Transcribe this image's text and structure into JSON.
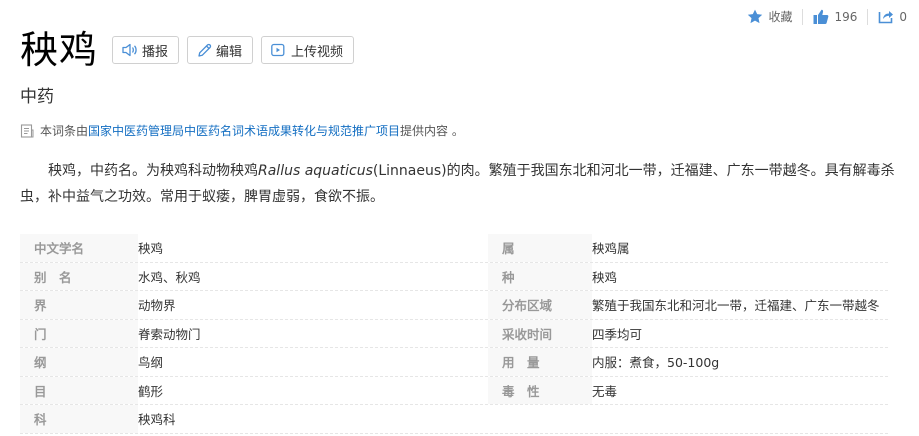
{
  "actions": {
    "favorite_label": "收藏",
    "like_count": "196",
    "share_count": "0"
  },
  "entry": {
    "title": "秧鸡",
    "subtitle": "中药",
    "buttons": {
      "broadcast": "播报",
      "edit": "编辑",
      "upload_video": "上传视频"
    }
  },
  "source": {
    "prefix": "本词条由",
    "link": "国家中医药管理局中医药名词术语成果转化与规范推广项目",
    "suffix": " 提供内容 。"
  },
  "summary": {
    "part1": "秧鸡，中药名。为秧鸡科动物秧鸡",
    "latin": "Rallus aquaticus",
    "part2": "(Linnaeus)的肉。繁殖于我国东北和河北一带，迁福建、广东一带越冬。具有解毒杀虫，补中益气之功效。常用于蚁瘘，脾胃虚弱，食欲不振。"
  },
  "infobox": {
    "left": [
      {
        "label": "中文学名",
        "value": "秧鸡"
      },
      {
        "label": "别　名",
        "value": "水鸡、秋鸡"
      },
      {
        "label": "界",
        "value": "动物界"
      },
      {
        "label": "门",
        "value": "脊索动物门"
      },
      {
        "label": "纲",
        "value": "鸟纲"
      },
      {
        "label": "目",
        "value": "鹤形"
      },
      {
        "label": "科",
        "value": "秧鸡科"
      }
    ],
    "right": [
      {
        "label": "属",
        "value": "秧鸡属"
      },
      {
        "label": "种",
        "value": "秧鸡"
      },
      {
        "label": "分布区域",
        "value": "繁殖于我国东北和河北一带，迁福建、广东一带越冬"
      },
      {
        "label": "采收时间",
        "value": "四季均可"
      },
      {
        "label": "用　量",
        "value": "内服：煮食，50-100g"
      },
      {
        "label": "毒　性",
        "value": "无毒"
      }
    ]
  },
  "colors": {
    "link": "#136ec2",
    "icon_blue": "#4a8fd6"
  }
}
